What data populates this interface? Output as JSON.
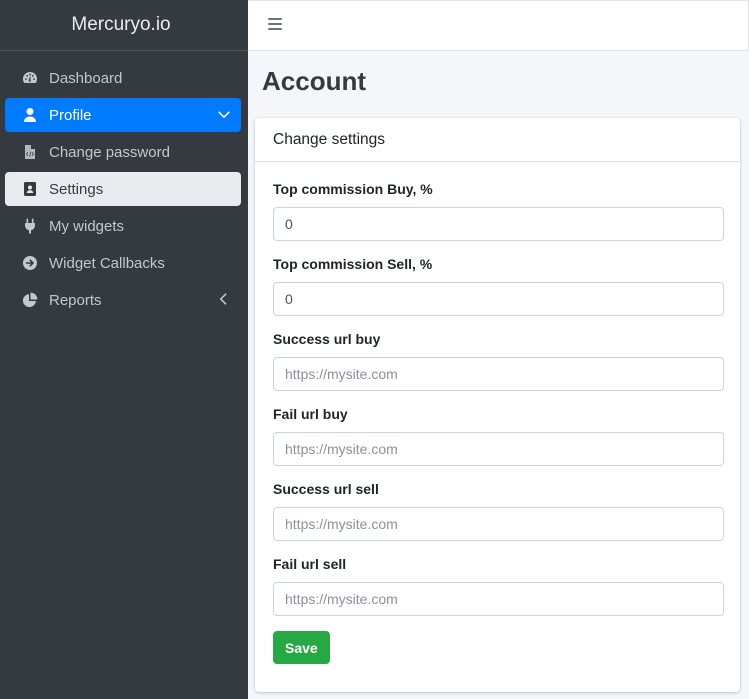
{
  "brand": "Mercuryo.io",
  "sidebar": {
    "items": [
      {
        "label": "Dashboard",
        "icon": "tachometer-icon"
      },
      {
        "label": "Profile",
        "icon": "user-icon"
      },
      {
        "label": "Change password",
        "icon": "file-code-icon"
      },
      {
        "label": "Settings",
        "icon": "address-card-icon"
      },
      {
        "label": "My widgets",
        "icon": "plug-icon"
      },
      {
        "label": "Widget Callbacks",
        "icon": "arrow-circle-right-icon"
      },
      {
        "label": "Reports",
        "icon": "pie-chart-icon"
      }
    ]
  },
  "page": {
    "title": "Account"
  },
  "card": {
    "header": "Change settings",
    "fields": [
      {
        "label": "Top commission Buy, %",
        "value": "0",
        "placeholder": ""
      },
      {
        "label": "Top commission Sell, %",
        "value": "0",
        "placeholder": ""
      },
      {
        "label": "Success url buy",
        "value": "",
        "placeholder": "https://mysite.com"
      },
      {
        "label": "Fail url buy",
        "value": "",
        "placeholder": "https://mysite.com"
      },
      {
        "label": "Success url sell",
        "value": "",
        "placeholder": "https://mysite.com"
      },
      {
        "label": "Fail url sell",
        "value": "",
        "placeholder": "https://mysite.com"
      }
    ],
    "save_label": "Save"
  },
  "colors": {
    "sidebar_bg": "#343a40",
    "active": "#007bff",
    "save": "#28a745"
  }
}
